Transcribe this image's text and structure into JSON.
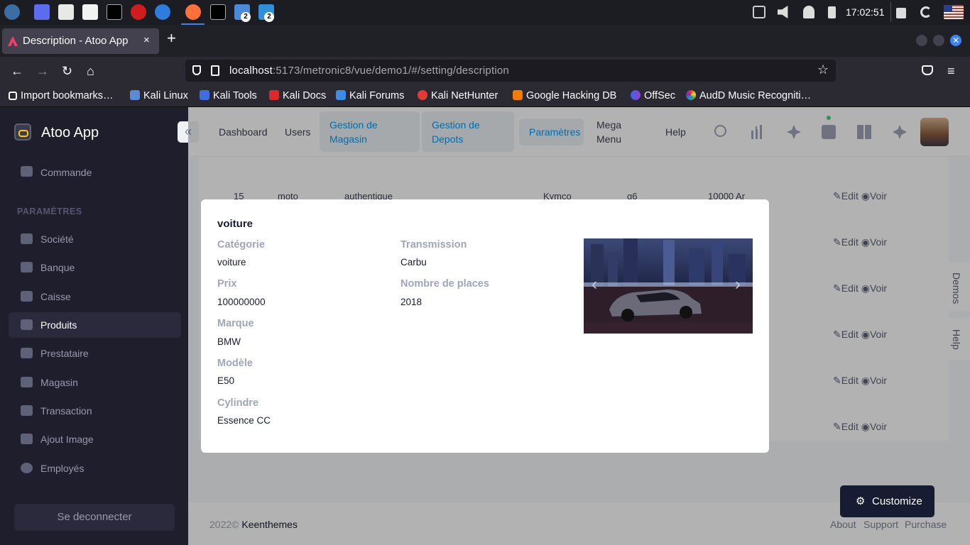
{
  "taskbar": {
    "clock": "17:02:51",
    "badge_a": "2",
    "badge_b": "2"
  },
  "browser": {
    "tab_title": "Description - Atoo App",
    "tab_close": "×",
    "new_tab": "+",
    "url_host": "localhost",
    "url_path": ":5173/metronic8/vue/demo1/#/setting/description",
    "bookmarks": [
      "Import bookmarks…",
      "Kali Linux",
      "Kali Tools",
      "Kali Docs",
      "Kali Forums",
      "Kali NetHunter",
      "Google Hacking DB",
      "OffSec",
      "AudD Music Recogniti…"
    ]
  },
  "app": {
    "name": "Atoo App",
    "collapse_icon": "«"
  },
  "sidebar": {
    "top_item": "Commande",
    "heading": "PARAMÈTRES",
    "items": [
      {
        "label": "Société",
        "icon": "bank-icon"
      },
      {
        "label": "Banque",
        "icon": "card-icon"
      },
      {
        "label": "Caisse",
        "icon": "wallet-icon"
      },
      {
        "label": "Produits",
        "icon": "grid-icon"
      },
      {
        "label": "Prestataire",
        "icon": "fingerprint-icon"
      },
      {
        "label": "Magasin",
        "icon": "store-icon"
      },
      {
        "label": "Transaction",
        "icon": "send-icon"
      },
      {
        "label": "Ajout Image",
        "icon": "layers-icon"
      },
      {
        "label": "Employés",
        "icon": "user-icon"
      }
    ],
    "active": "Produits",
    "logout": "Se deconnecter"
  },
  "header": {
    "menu": {
      "dashboard": "Dashboard",
      "users": "Users",
      "magasin_1": "Gestion de",
      "magasin_2": "Magasin",
      "depots_1": "Gestion de",
      "depots_2": "Depots",
      "parametres": "Paramètres",
      "mega_1": "Mega",
      "mega_2": "Menu",
      "help": "Help"
    },
    "accent": "#009ef7"
  },
  "table": {
    "first_row": {
      "id": "15",
      "type": "moto",
      "condition": "authentique",
      "brand": "Kymco",
      "model": "g6",
      "price": "10000 Ar"
    },
    "edit_label": "Edit",
    "view_label": "Voir"
  },
  "modal": {
    "title": "voiture",
    "fields": {
      "categorie_label": "Catégorie",
      "categorie": "voiture",
      "prix_label": "Prix",
      "prix": "100000000",
      "marque_label": "Marque",
      "marque": "BMW",
      "modele_label": "Modèle",
      "modele": "E50",
      "cylindre_label": "Cylindre",
      "cylindre": "Essence CC",
      "transmission_label": "Transmission",
      "transmission": "Carbu",
      "places_label": "Nombre de places",
      "places": "2018"
    },
    "carousel_prev": "‹",
    "carousel_next": "›"
  },
  "footer": {
    "year": "2022©",
    "brand": "Keenthemes",
    "links": [
      "About",
      "Support",
      "Purchase"
    ]
  },
  "customize": "Customize",
  "side_tabs": {
    "demos": "Demos",
    "help": "Help"
  }
}
